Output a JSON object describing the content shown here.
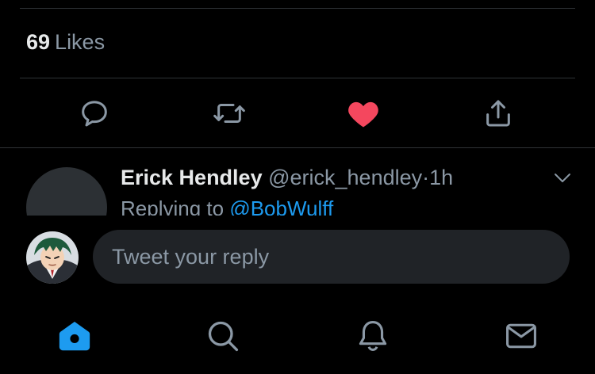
{
  "stats": {
    "likes_count": "69",
    "likes_label": "Likes"
  },
  "actions": {
    "reply_icon": "speech-bubble-icon",
    "retweet_icon": "retweet-icon",
    "like_icon": "heart-filled-icon",
    "share_icon": "share-icon"
  },
  "reply_tweet": {
    "author_name": "Erick Hendley",
    "author_handle": "@erick_hendley",
    "separator": "·",
    "time": "1h",
    "replying_to_label": "Replying to",
    "replying_to_user": "@BobWulff"
  },
  "composer": {
    "placeholder": "Tweet your reply"
  },
  "tabbar": {
    "items": [
      {
        "name": "home",
        "icon": "home-icon",
        "active": true
      },
      {
        "name": "search",
        "icon": "search-icon",
        "active": false
      },
      {
        "name": "notifications",
        "icon": "bell-icon",
        "active": false
      },
      {
        "name": "messages",
        "icon": "mail-icon",
        "active": false
      }
    ]
  },
  "colors": {
    "accent": "#1d9bf0",
    "like": "#f4475e",
    "icon_gray": "#8b98a5"
  }
}
